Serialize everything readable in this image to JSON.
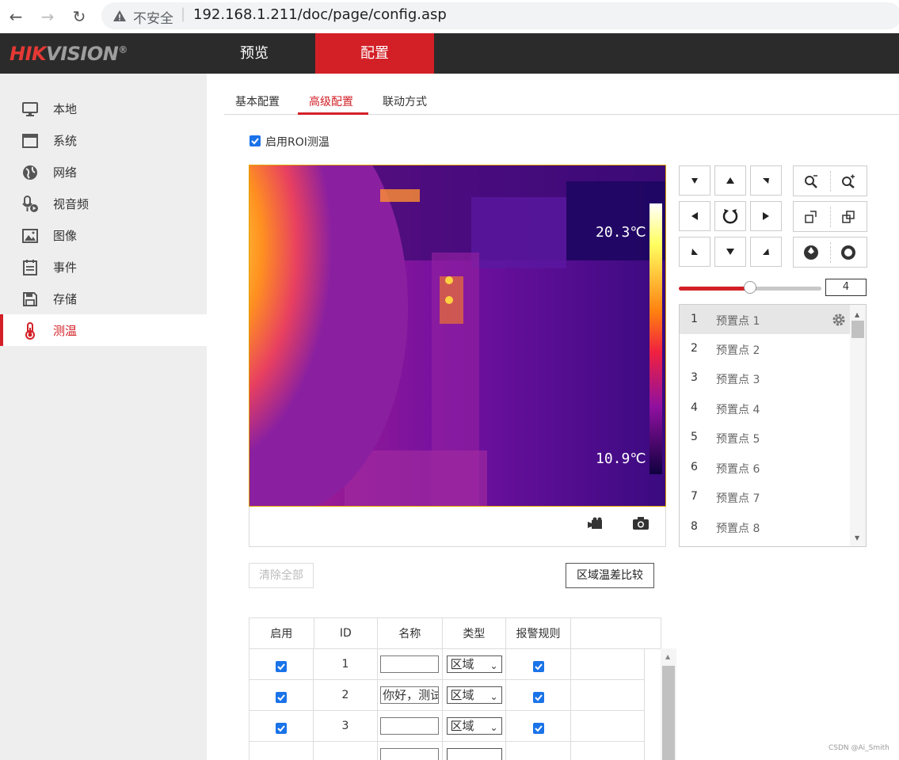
{
  "browser": {
    "back_icon": "arrow-left-icon",
    "forward_icon": "arrow-right-icon",
    "reload_icon": "reload-icon",
    "insecure_label": "不安全",
    "url": "192.168.1.211/doc/page/config.asp"
  },
  "header": {
    "logo_red": "HIK",
    "logo_grey": "VISION",
    "logo_reg": "®",
    "nav": [
      {
        "label": "预览"
      },
      {
        "label": "配置",
        "active": true
      }
    ],
    "active_color": "#d32027"
  },
  "sidebar": {
    "items": [
      {
        "label": "本地",
        "icon": "monitor-icon"
      },
      {
        "label": "系统",
        "icon": "window-icon"
      },
      {
        "label": "网络",
        "icon": "globe-icon"
      },
      {
        "label": "视音频",
        "icon": "microphone-play-icon"
      },
      {
        "label": "图像",
        "icon": "image-icon"
      },
      {
        "label": "事件",
        "icon": "calendar-list-icon"
      },
      {
        "label": "存储",
        "icon": "floppy-disk-icon"
      },
      {
        "label": "测温",
        "icon": "thermometer-icon",
        "active": true
      }
    ]
  },
  "tabs": [
    {
      "label": "基本配置"
    },
    {
      "label": "高级配置",
      "active": true
    },
    {
      "label": "联动方式"
    }
  ],
  "roi": {
    "enable_label": "启用ROI测温",
    "checked": true
  },
  "thermal": {
    "max_temp": "20.3℃",
    "min_temp": "10.9℃"
  },
  "video_controls": {
    "record_icon": "video-camera-icon",
    "snapshot_icon": "camera-icon"
  },
  "ptz": {
    "speed_value": "4",
    "speed_fraction": 0.5
  },
  "presets": [
    {
      "num": "1",
      "name": "预置点 1"
    },
    {
      "num": "2",
      "name": "预置点 2"
    },
    {
      "num": "3",
      "name": "预置点 3"
    },
    {
      "num": "4",
      "name": "预置点 4"
    },
    {
      "num": "5",
      "name": "预置点 5"
    },
    {
      "num": "6",
      "name": "预置点 6"
    },
    {
      "num": "7",
      "name": "预置点 7"
    },
    {
      "num": "8",
      "name": "预置点 8"
    }
  ],
  "actions": {
    "clear_all": "清除全部",
    "compare": "区域温差比较"
  },
  "table": {
    "headers": [
      "启用",
      "ID",
      "名称",
      "类型",
      "报警规则"
    ],
    "rows": [
      {
        "enabled": true,
        "id": "1",
        "name": "",
        "type": "区域",
        "alarm": true
      },
      {
        "enabled": true,
        "id": "2",
        "name": "你好，测试",
        "type": "区域",
        "alarm": true
      },
      {
        "enabled": true,
        "id": "3",
        "name": "",
        "type": "区域",
        "alarm": true
      }
    ]
  },
  "footer": {
    "watermark": "CSDN @Ai_Smith"
  }
}
